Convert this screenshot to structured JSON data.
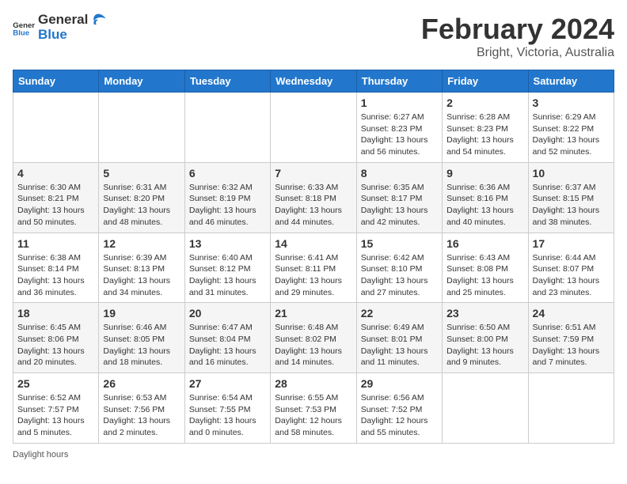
{
  "header": {
    "logo_general": "General",
    "logo_blue": "Blue",
    "title": "February 2024",
    "location": "Bright, Victoria, Australia"
  },
  "days_of_week": [
    "Sunday",
    "Monday",
    "Tuesday",
    "Wednesday",
    "Thursday",
    "Friday",
    "Saturday"
  ],
  "weeks": [
    [
      {
        "day": "",
        "info": ""
      },
      {
        "day": "",
        "info": ""
      },
      {
        "day": "",
        "info": ""
      },
      {
        "day": "",
        "info": ""
      },
      {
        "day": "1",
        "info": "Sunrise: 6:27 AM\nSunset: 8:23 PM\nDaylight: 13 hours and 56 minutes."
      },
      {
        "day": "2",
        "info": "Sunrise: 6:28 AM\nSunset: 8:23 PM\nDaylight: 13 hours and 54 minutes."
      },
      {
        "day": "3",
        "info": "Sunrise: 6:29 AM\nSunset: 8:22 PM\nDaylight: 13 hours and 52 minutes."
      }
    ],
    [
      {
        "day": "4",
        "info": "Sunrise: 6:30 AM\nSunset: 8:21 PM\nDaylight: 13 hours and 50 minutes."
      },
      {
        "day": "5",
        "info": "Sunrise: 6:31 AM\nSunset: 8:20 PM\nDaylight: 13 hours and 48 minutes."
      },
      {
        "day": "6",
        "info": "Sunrise: 6:32 AM\nSunset: 8:19 PM\nDaylight: 13 hours and 46 minutes."
      },
      {
        "day": "7",
        "info": "Sunrise: 6:33 AM\nSunset: 8:18 PM\nDaylight: 13 hours and 44 minutes."
      },
      {
        "day": "8",
        "info": "Sunrise: 6:35 AM\nSunset: 8:17 PM\nDaylight: 13 hours and 42 minutes."
      },
      {
        "day": "9",
        "info": "Sunrise: 6:36 AM\nSunset: 8:16 PM\nDaylight: 13 hours and 40 minutes."
      },
      {
        "day": "10",
        "info": "Sunrise: 6:37 AM\nSunset: 8:15 PM\nDaylight: 13 hours and 38 minutes."
      }
    ],
    [
      {
        "day": "11",
        "info": "Sunrise: 6:38 AM\nSunset: 8:14 PM\nDaylight: 13 hours and 36 minutes."
      },
      {
        "day": "12",
        "info": "Sunrise: 6:39 AM\nSunset: 8:13 PM\nDaylight: 13 hours and 34 minutes."
      },
      {
        "day": "13",
        "info": "Sunrise: 6:40 AM\nSunset: 8:12 PM\nDaylight: 13 hours and 31 minutes."
      },
      {
        "day": "14",
        "info": "Sunrise: 6:41 AM\nSunset: 8:11 PM\nDaylight: 13 hours and 29 minutes."
      },
      {
        "day": "15",
        "info": "Sunrise: 6:42 AM\nSunset: 8:10 PM\nDaylight: 13 hours and 27 minutes."
      },
      {
        "day": "16",
        "info": "Sunrise: 6:43 AM\nSunset: 8:08 PM\nDaylight: 13 hours and 25 minutes."
      },
      {
        "day": "17",
        "info": "Sunrise: 6:44 AM\nSunset: 8:07 PM\nDaylight: 13 hours and 23 minutes."
      }
    ],
    [
      {
        "day": "18",
        "info": "Sunrise: 6:45 AM\nSunset: 8:06 PM\nDaylight: 13 hours and 20 minutes."
      },
      {
        "day": "19",
        "info": "Sunrise: 6:46 AM\nSunset: 8:05 PM\nDaylight: 13 hours and 18 minutes."
      },
      {
        "day": "20",
        "info": "Sunrise: 6:47 AM\nSunset: 8:04 PM\nDaylight: 13 hours and 16 minutes."
      },
      {
        "day": "21",
        "info": "Sunrise: 6:48 AM\nSunset: 8:02 PM\nDaylight: 13 hours and 14 minutes."
      },
      {
        "day": "22",
        "info": "Sunrise: 6:49 AM\nSunset: 8:01 PM\nDaylight: 13 hours and 11 minutes."
      },
      {
        "day": "23",
        "info": "Sunrise: 6:50 AM\nSunset: 8:00 PM\nDaylight: 13 hours and 9 minutes."
      },
      {
        "day": "24",
        "info": "Sunrise: 6:51 AM\nSunset: 7:59 PM\nDaylight: 13 hours and 7 minutes."
      }
    ],
    [
      {
        "day": "25",
        "info": "Sunrise: 6:52 AM\nSunset: 7:57 PM\nDaylight: 13 hours and 5 minutes."
      },
      {
        "day": "26",
        "info": "Sunrise: 6:53 AM\nSunset: 7:56 PM\nDaylight: 13 hours and 2 minutes."
      },
      {
        "day": "27",
        "info": "Sunrise: 6:54 AM\nSunset: 7:55 PM\nDaylight: 13 hours and 0 minutes."
      },
      {
        "day": "28",
        "info": "Sunrise: 6:55 AM\nSunset: 7:53 PM\nDaylight: 12 hours and 58 minutes."
      },
      {
        "day": "29",
        "info": "Sunrise: 6:56 AM\nSunset: 7:52 PM\nDaylight: 12 hours and 55 minutes."
      },
      {
        "day": "",
        "info": ""
      },
      {
        "day": "",
        "info": ""
      }
    ]
  ],
  "footer": {
    "daylight_label": "Daylight hours"
  }
}
